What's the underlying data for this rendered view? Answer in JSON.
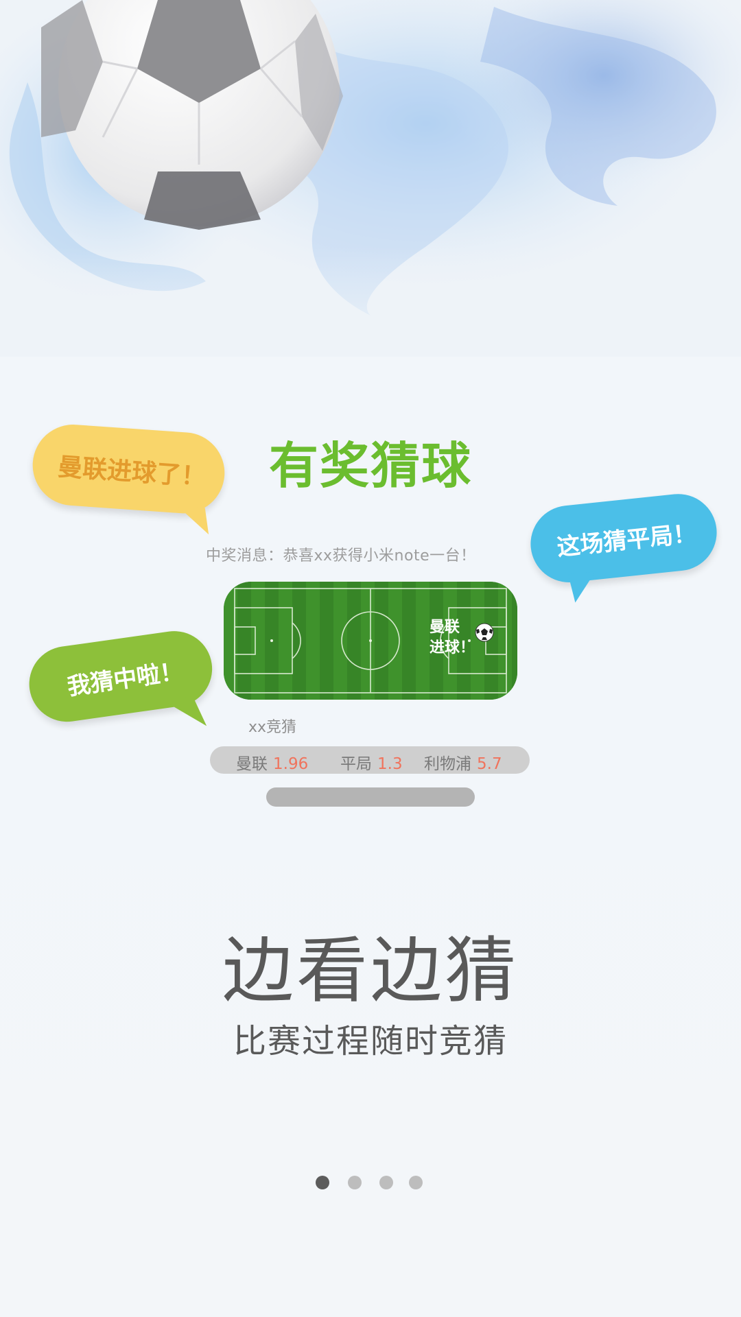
{
  "title": "有奖猜球",
  "bubbles": {
    "yellow": "曼联进球了！",
    "blue": "这场猜平局！",
    "green": "我猜中啦！"
  },
  "news": "中奖消息：恭喜xx获得小米note一台！",
  "pitch": {
    "goal_line1": "曼联",
    "goal_line2": "进球！"
  },
  "match_name": "xx竞猜",
  "odds": [
    {
      "team": "曼联",
      "value": "1.96"
    },
    {
      "team": "平局",
      "value": "1.3"
    },
    {
      "team": "利物浦",
      "value": "5.7"
    }
  ],
  "headline": "边看边猜",
  "subhead": "比赛过程随时竞猜",
  "pager": {
    "total": 4,
    "active": 0
  },
  "colors": {
    "title_green": "#6bbd2f",
    "bubble_yellow": "#f9d56a",
    "bubble_blue": "#4bbfe8",
    "bubble_green": "#8dc03a",
    "odds_value": "#f0735c"
  }
}
